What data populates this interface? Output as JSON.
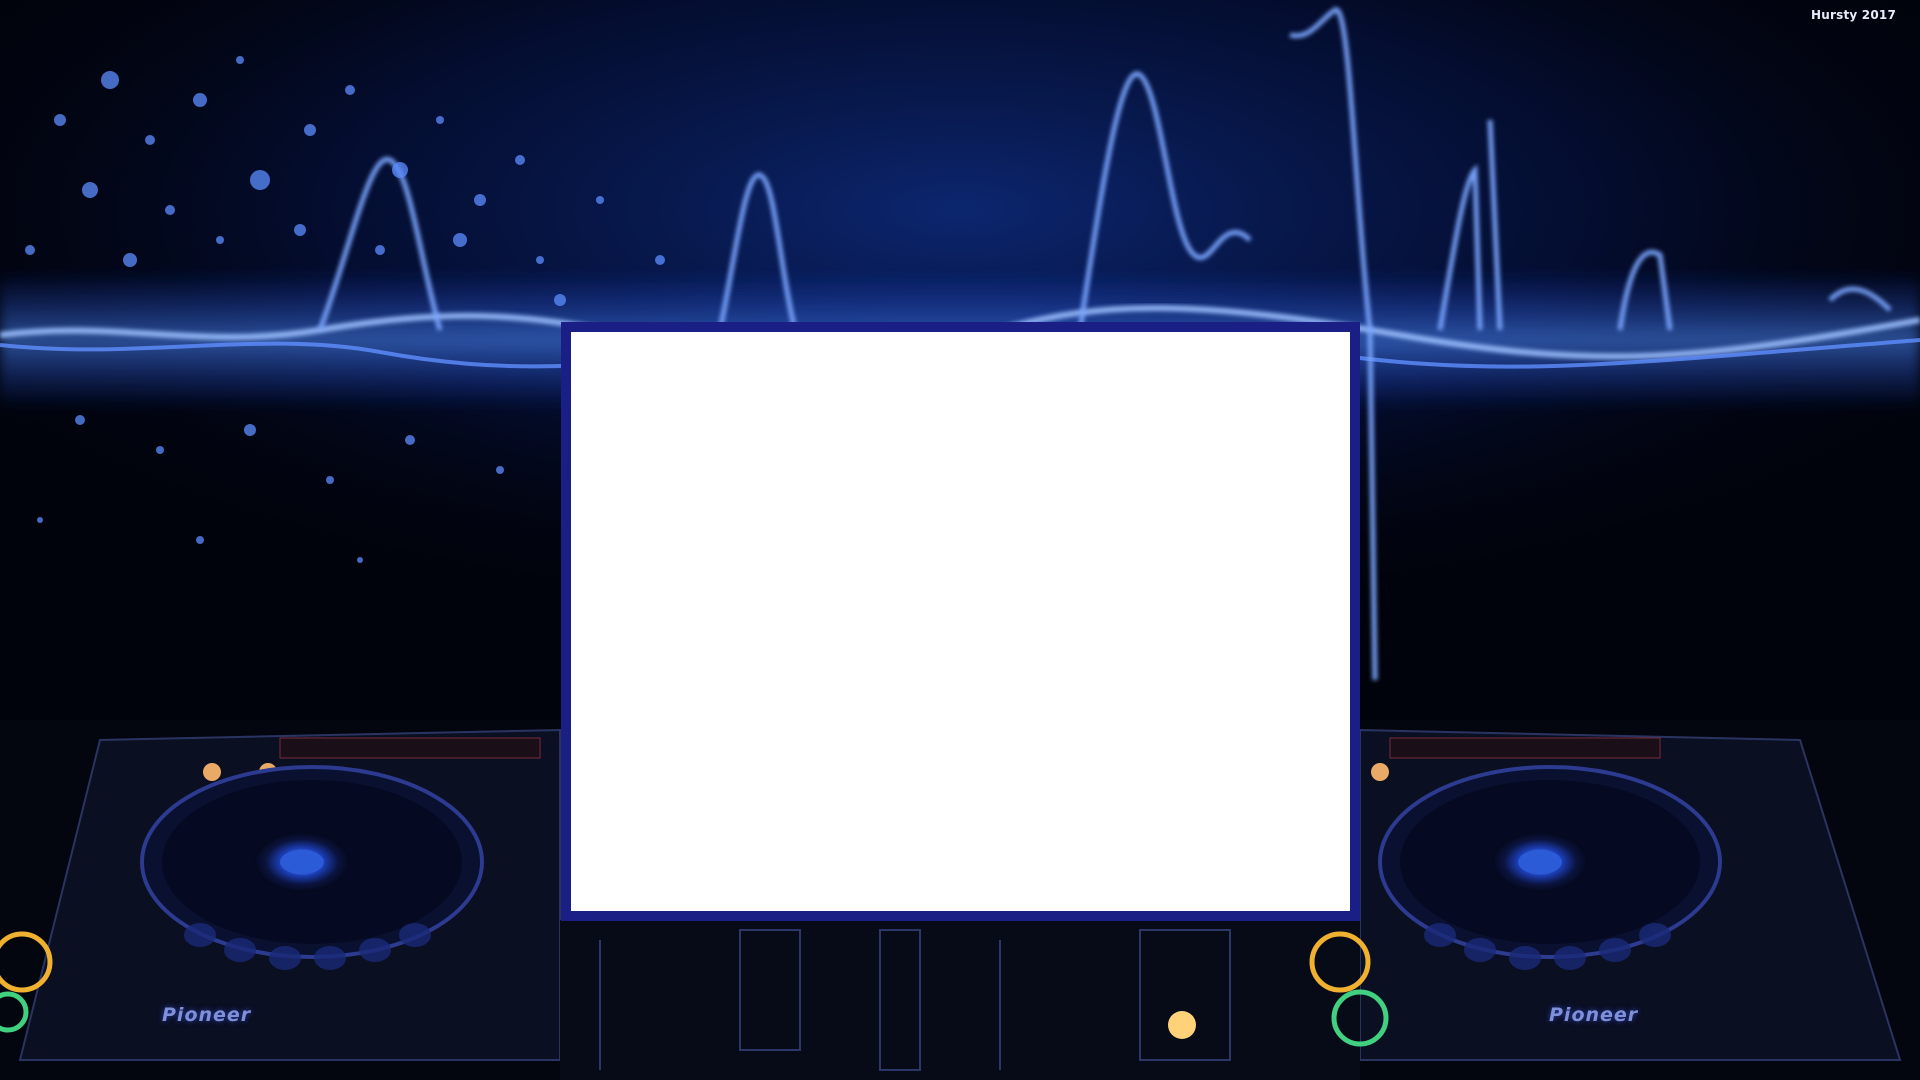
{
  "watermark": "Hursty 2017",
  "decks": {
    "left_brand": "Pioneer",
    "right_brand": "Pioneer"
  },
  "colors": {
    "background": "#01030c",
    "wave_glow": "#3f7dff",
    "panel_border": "#1a1f86",
    "panel_fill": "#ffffff"
  },
  "icons": {
    "left_jog": "jog-wheel-icon",
    "right_jog": "jog-wheel-icon",
    "waveform": "sound-wave-icon"
  }
}
